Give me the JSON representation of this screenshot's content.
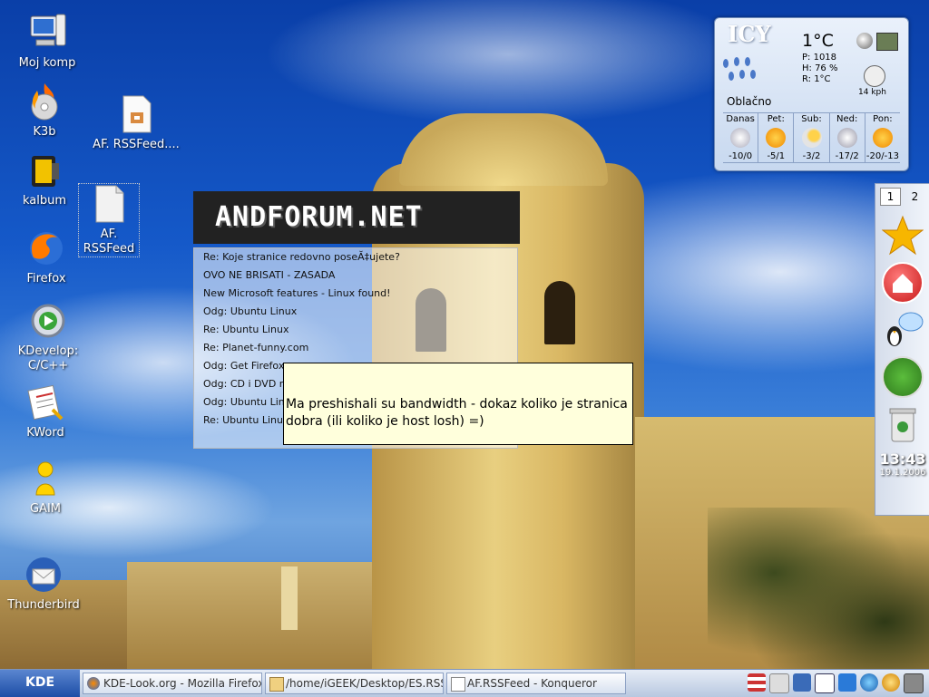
{
  "desktop": {
    "icons": [
      {
        "id": "moj-komp",
        "label": "Moj komp"
      },
      {
        "id": "k3b",
        "label": "K3b"
      },
      {
        "id": "kalbum",
        "label": "kalbum"
      },
      {
        "id": "firefox",
        "label": "Firefox"
      },
      {
        "id": "kdevelop",
        "label": "KDevelop: C/C++"
      },
      {
        "id": "kword",
        "label": "KWord"
      },
      {
        "id": "gaim",
        "label": "GAIM"
      },
      {
        "id": "thunderbird",
        "label": "Thunderbird"
      },
      {
        "id": "af-rssfeed-archive",
        "label": "AF. RSSFeed...."
      },
      {
        "id": "af-rssfeed",
        "label": "AF. RSSFeed"
      }
    ]
  },
  "weather": {
    "station_label": "ICY",
    "temperature": "1°C",
    "pressure": "P:  1018",
    "humidity": "H:  76 %",
    "real_feel": "R:  1°C",
    "wind": "14 kph",
    "condition": "Oblačno",
    "forecast": [
      {
        "day": "Danas",
        "temps": "-10/0",
        "icon": "cloudy-icon"
      },
      {
        "day": "Pet:",
        "temps": "-5/1",
        "icon": "sun-icon"
      },
      {
        "day": "Sub:",
        "temps": "-3/2",
        "icon": "partly-sunny-icon"
      },
      {
        "day": "Ned:",
        "temps": "-17/2",
        "icon": "snow-icon"
      },
      {
        "day": "Pon:",
        "temps": "-20/-13",
        "icon": "sun-icon"
      }
    ]
  },
  "sidepanel": {
    "desktops": [
      "1",
      "2"
    ],
    "clock_time": "13:43",
    "clock_date": "19.1.2006"
  },
  "forum": {
    "title": "ANDFORUM.NET",
    "items": [
      "Re: Koje stranice redovno poseĂ‡ujete?",
      "OVO NE BRISATI - ZASADA",
      "New Microsoft features - Linux found!",
      "Odg: Ubuntu Linux",
      "Re: Ubuntu Linux",
      "Re: Planet-funny.com",
      "Odg: Get Firefox",
      "Odg: CD i DVD re",
      "Odg: Ubuntu Linu",
      "Re: Ubuntu Linux"
    ]
  },
  "tooltip": {
    "line1": "Ma preshishali su bandwidth - dokaz koliko je stranica",
    "line2": "dobra (ili koliko je host losh) =)"
  },
  "taskbar": {
    "start_label": "KDE",
    "tasks": [
      {
        "label": "KDE-Look.org - Mozilla Firefox",
        "icon": "firefox-icon"
      },
      {
        "label": "/home/iGEEK/Desktop/ES.RSS",
        "icon": "folder-icon"
      },
      {
        "label": "AF.RSSFeed - Konqueror",
        "icon": "document-icon"
      }
    ]
  }
}
